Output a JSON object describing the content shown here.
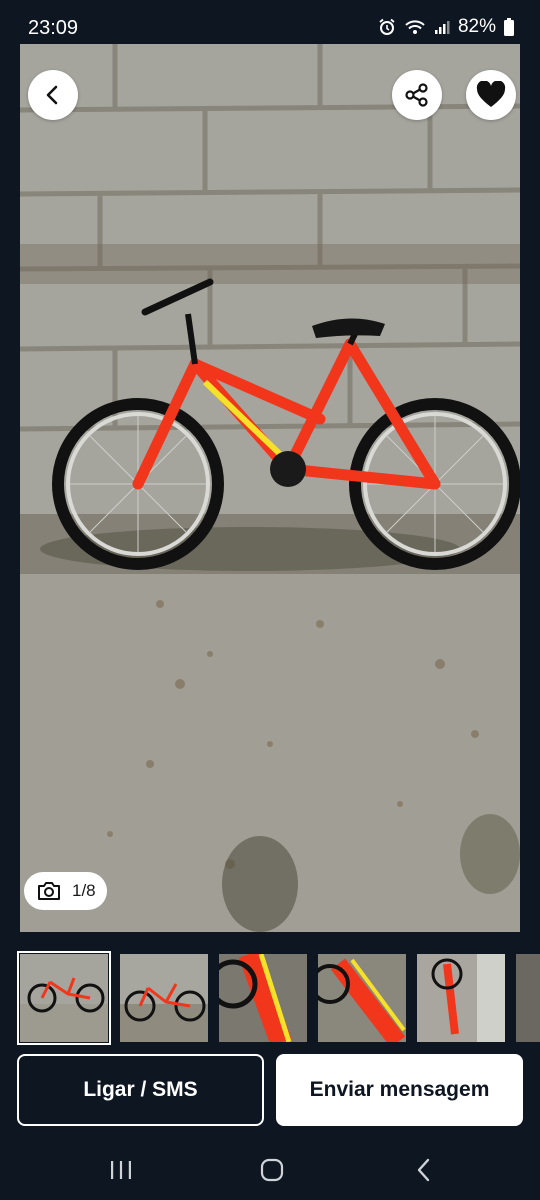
{
  "status_bar": {
    "time": "23:09",
    "battery": "82%",
    "icons": [
      "alarm-icon",
      "wifi-icon",
      "signal-icon",
      "battery-icon"
    ]
  },
  "gallery": {
    "counter": "1/8",
    "icons": [
      "back-icon",
      "share-icon",
      "heart-icon",
      "camera-icon"
    ],
    "thumbnails": [
      {
        "description_icon": "photo-thumbnail",
        "selected": true
      },
      {
        "description_icon": "photo-thumbnail",
        "selected": false
      },
      {
        "description_icon": "photo-thumbnail",
        "selected": false
      },
      {
        "description_icon": "photo-thumbnail",
        "selected": false
      },
      {
        "description_icon": "photo-thumbnail",
        "selected": false
      }
    ]
  },
  "actions": {
    "call_label": "Ligar / SMS",
    "message_label": "Enviar mensagem"
  },
  "nav": {
    "icons": [
      "recent-apps-icon",
      "home-icon",
      "back-icon"
    ]
  },
  "colors": {
    "background": "#0e1621",
    "bike_frame": "#f2361c",
    "bike_accent": "#f5e12a"
  }
}
